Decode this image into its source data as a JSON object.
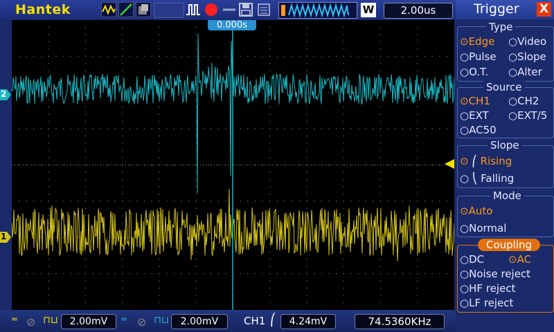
{
  "app": {
    "brand": "Hantek"
  },
  "toolbar": {
    "time_base": "2.00us",
    "mode_button": "W"
  },
  "screen": {
    "trigger_time_label": "0.000s",
    "ch1_marker": "1",
    "ch2_marker": "2"
  },
  "trigger_panel": {
    "title": "Trigger",
    "close": "X",
    "type": {
      "header": "Type",
      "options": [
        "Edge",
        "Video",
        "Pulse",
        "Slope",
        "O.T.",
        "Alter"
      ],
      "selected": "Edge"
    },
    "source": {
      "header": "Source",
      "options": [
        "CH1",
        "CH2",
        "EXT",
        "EXT/5",
        "AC50"
      ],
      "selected": "CH1"
    },
    "slope": {
      "header": "Slope",
      "options": [
        "Rising",
        "Falling"
      ],
      "selected": "Rising"
    },
    "mode": {
      "header": "Mode",
      "options": [
        "Auto",
        "Normal"
      ],
      "selected": "Auto"
    },
    "coupling": {
      "header": "Coupling",
      "options": [
        "DC",
        "AC",
        "Noise reject",
        "HF reject",
        "LF reject"
      ],
      "selected": "AC"
    }
  },
  "bottom": {
    "ch1_volts": "2.00mV",
    "ch2_volts": "2.00mV",
    "trig_source": "CH1",
    "trig_level": "4.24mV",
    "frequency": "74.5360KHz"
  },
  "colors": {
    "ch1": "#d4c41a",
    "ch2": "#1ab8c4",
    "accent": "#ff9a1a",
    "brand": "#f5e000"
  }
}
